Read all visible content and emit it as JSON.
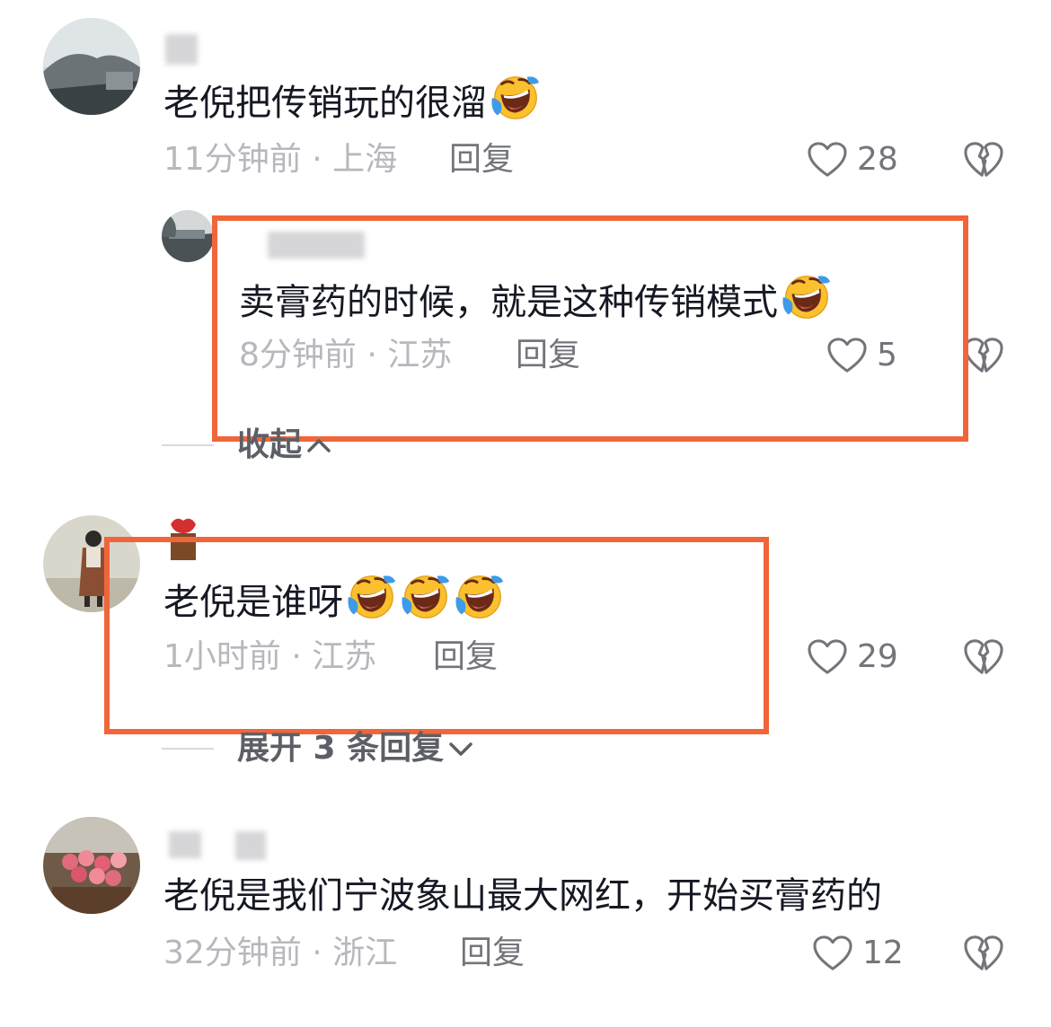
{
  "comments": [
    {
      "text": "老倪把传销玩的很溜",
      "emoji_count": 1,
      "time": "11分钟前",
      "location": "上海",
      "reply_label": "回复",
      "likes": "28",
      "replies": [
        {
          "text": "卖膏药的时候，就是这种传销模式",
          "emoji_count": 1,
          "time": "8分钟前",
          "location": "江苏",
          "reply_label": "回复",
          "likes": "5"
        }
      ],
      "thread_toggle": "收起"
    },
    {
      "text": "老倪是谁呀",
      "emoji_count": 3,
      "time": "1小时前",
      "location": "江苏",
      "reply_label": "回复",
      "likes": "29",
      "thread_toggle": "展开 3 条回复"
    },
    {
      "text": "老倪是我们宁波象山最大网红，开始买膏药的",
      "emoji_count": 0,
      "time": "32分钟前",
      "location": "浙江",
      "reply_label": "回复",
      "likes": "12"
    }
  ],
  "meta_separator": "·",
  "icons": {
    "like": "heart-outline-icon",
    "dislike": "broken-heart-icon",
    "emoji": "laughing-crying-emoji",
    "chevron_up": "chevron-up-icon",
    "chevron_down": "chevron-down-icon"
  },
  "colors": {
    "highlight_border": "#f0663a",
    "primary_text": "#161823",
    "meta_text": "#b7b8bd",
    "action_text": "#73757b"
  }
}
